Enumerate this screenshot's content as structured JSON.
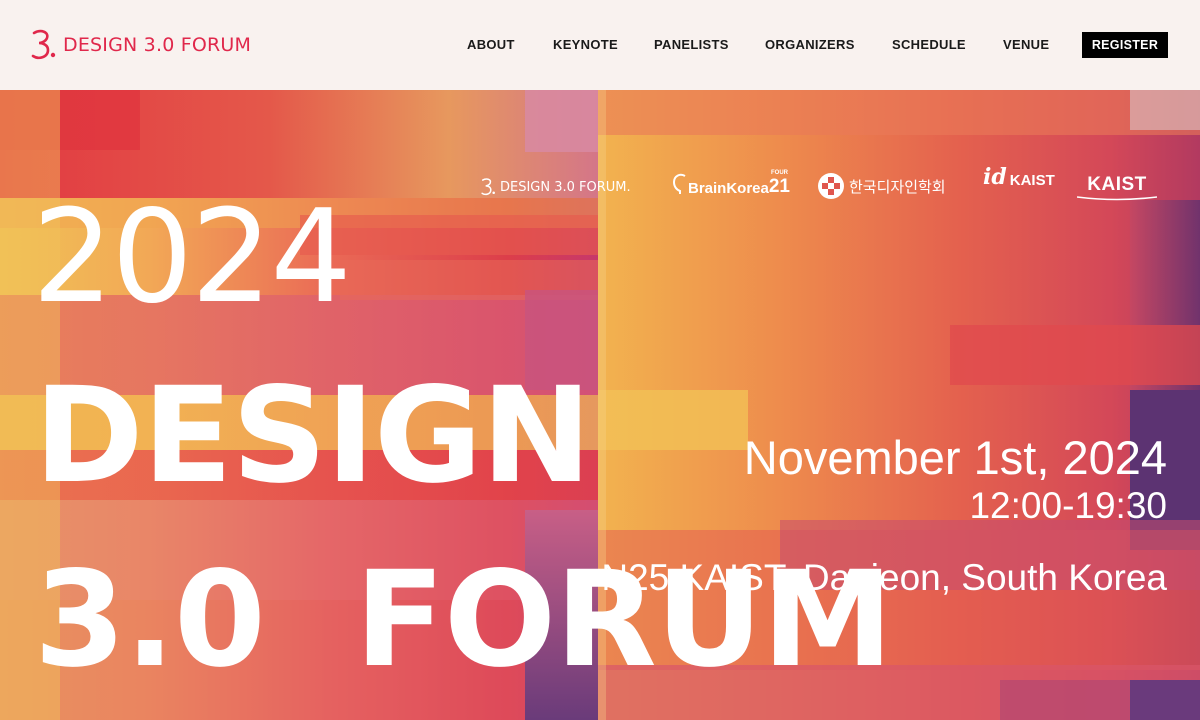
{
  "site": {
    "brand_name": "DESIGN 3.0 FORUM",
    "brand_color": "#e0284b"
  },
  "nav": {
    "items": [
      {
        "label": "ABOUT"
      },
      {
        "label": "KEYNOTE"
      },
      {
        "label": "PANELISTS"
      },
      {
        "label": "ORGANIZERS"
      },
      {
        "label": "SCHEDULE"
      },
      {
        "label": "VENUE"
      }
    ],
    "register_label": "REGISTER"
  },
  "hero": {
    "partner_logos": [
      {
        "name": "design-forum-logo",
        "text": "DESIGN 3.0 FORUM."
      },
      {
        "name": "brainkorea21-logo",
        "text": "BrainKorea",
        "number": "21",
        "superscript": "FOUR"
      },
      {
        "name": "korea-design-society-logo",
        "text": "한국디자인학회"
      },
      {
        "name": "id-kaist-logo",
        "mark": "id",
        "text": "KAIST"
      },
      {
        "name": "kaist-logo",
        "text": "KAIST"
      }
    ],
    "title_year": "2024",
    "title_line1": "DESIGN",
    "title_line2": "3.0  FORUM",
    "date": "November 1st, 2024",
    "time": "12:00-19:30",
    "venue": "N25 KAIST, Daejeon, South Korea"
  },
  "colors": {
    "nav_bg": "#f9f2ef",
    "register_bg": "#000000",
    "gradient_red": "#e23a42",
    "gradient_orange": "#ee8a4a",
    "gradient_yellow": "#f0c255",
    "gradient_pink": "#d95a78",
    "gradient_purple": "#5a3070"
  }
}
